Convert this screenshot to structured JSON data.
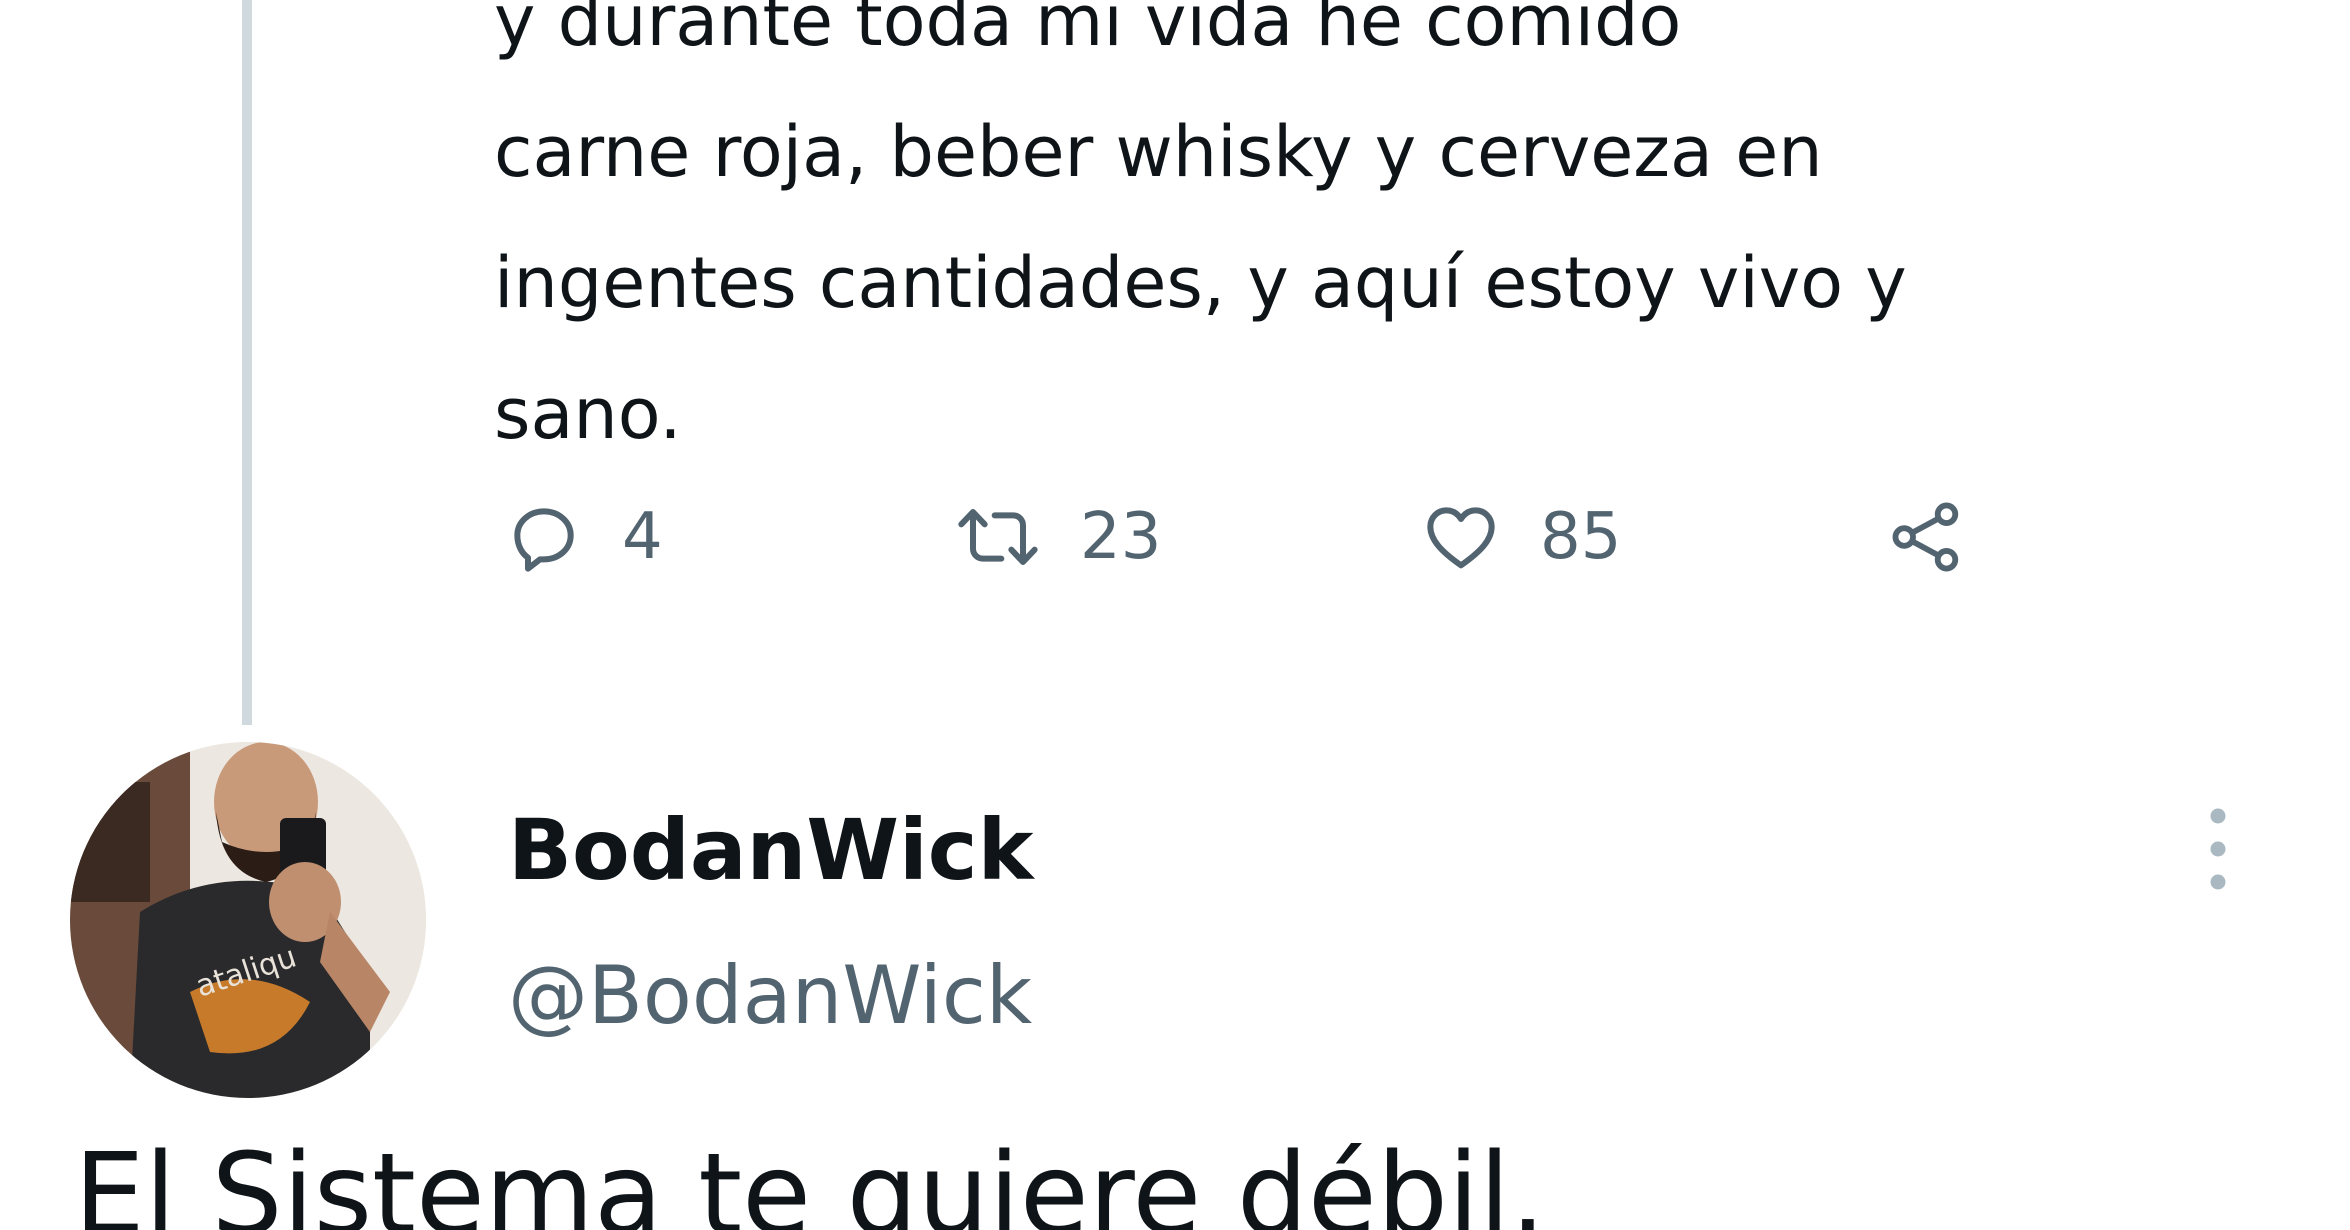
{
  "quoted_tweet": {
    "text_lines": [
      "y durante toda mi vida he comido",
      "carne roja, beber whisky y cerveza en",
      "ingentes cantidades, y aquí estoy vivo y",
      "sano."
    ],
    "actions": {
      "reply": {
        "icon": "comment-icon",
        "count": "4"
      },
      "retweet": {
        "icon": "retweet-icon",
        "count": "23"
      },
      "like": {
        "icon": "heart-icon",
        "count": "85"
      },
      "share": {
        "icon": "share-icon"
      }
    }
  },
  "tweet": {
    "author": {
      "name": "BodanWick",
      "handle": "@BodanWick"
    },
    "more_icon": "vertical-ellipsis-icon",
    "text": "El Sistema te quiere débil."
  },
  "colors": {
    "text_primary": "#0f1419",
    "text_secondary": "#536471",
    "thread_line": "#cfd9de",
    "background": "#ffffff"
  }
}
